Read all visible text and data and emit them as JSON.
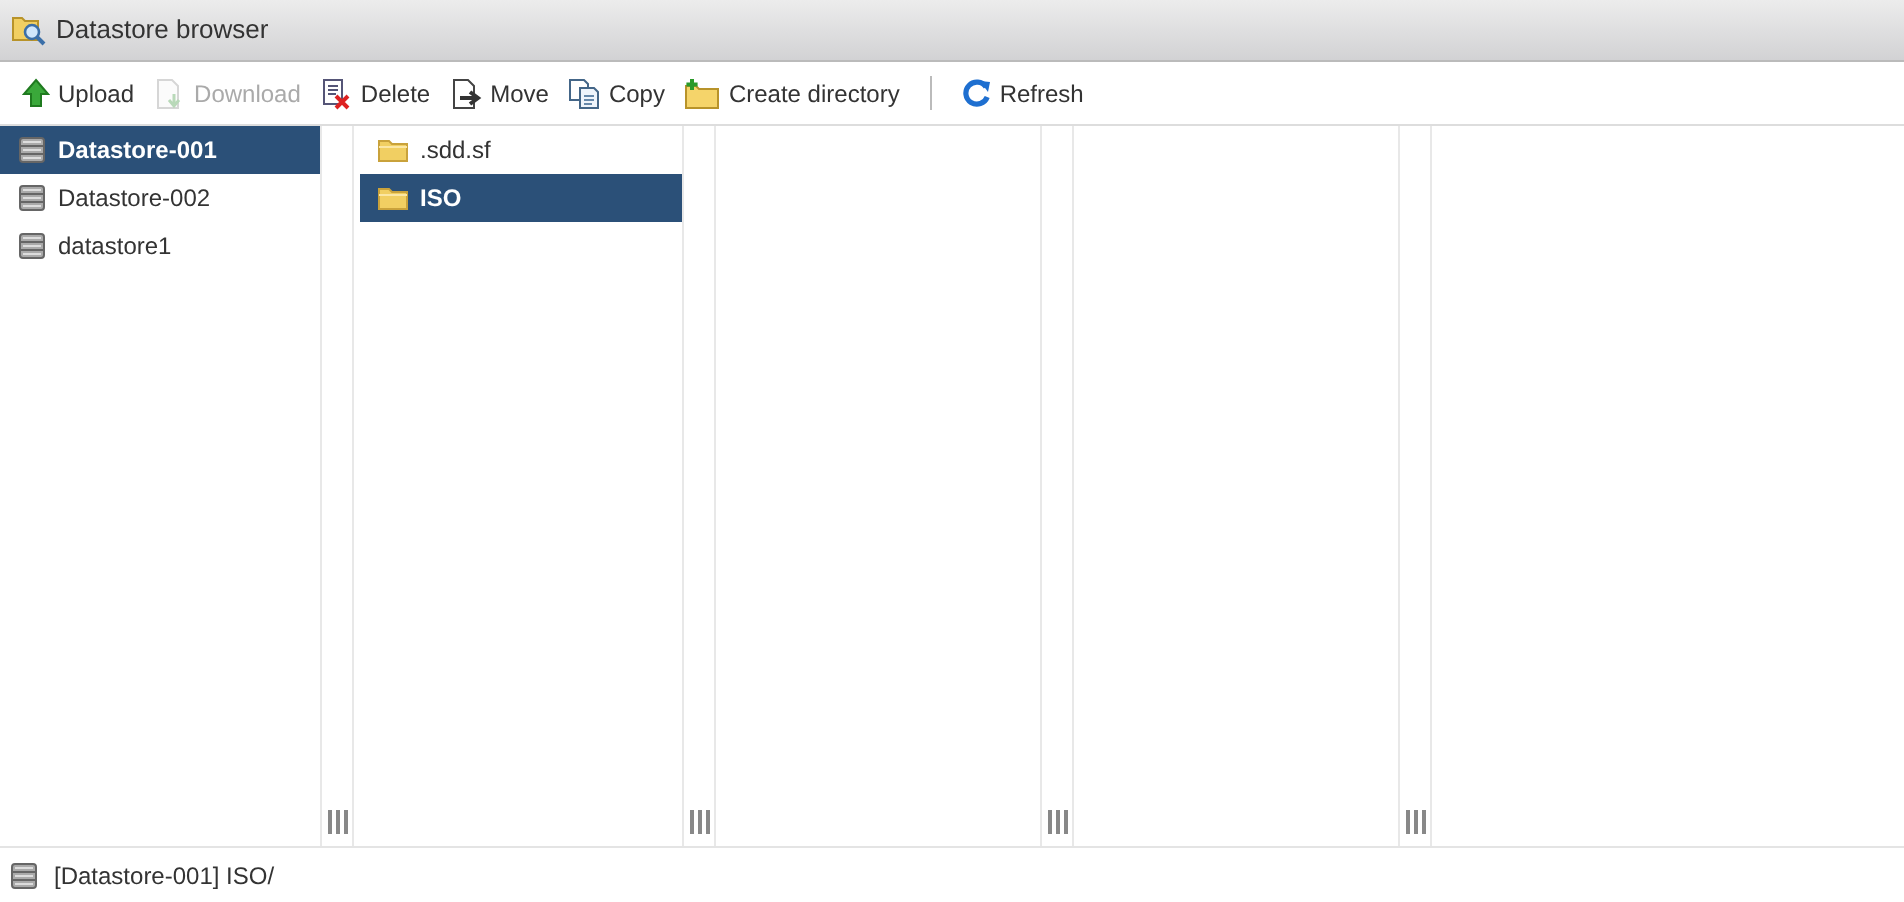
{
  "window": {
    "title": "Datastore browser"
  },
  "toolbar": [
    {
      "kind": "upload",
      "label": "Upload",
      "disabled": false
    },
    {
      "kind": "download",
      "label": "Download",
      "disabled": true
    },
    {
      "kind": "delete",
      "label": "Delete",
      "disabled": false
    },
    {
      "kind": "move",
      "label": "Move",
      "disabled": false
    },
    {
      "kind": "copy",
      "label": "Copy",
      "disabled": false
    },
    {
      "kind": "mkdir",
      "label": "Create directory",
      "disabled": false
    },
    {
      "kind": "separator"
    },
    {
      "kind": "refresh",
      "label": "Refresh",
      "disabled": false
    }
  ],
  "columns": [
    {
      "items": [
        {
          "kind": "datastore",
          "label": "Datastore-001",
          "selected": true
        },
        {
          "kind": "datastore",
          "label": "Datastore-002",
          "selected": false
        },
        {
          "kind": "datastore",
          "label": "datastore1",
          "selected": false
        }
      ]
    },
    {
      "items": [
        {
          "kind": "folder",
          "label": ".sdd.sf",
          "selected": false
        },
        {
          "kind": "folder",
          "label": "ISO",
          "selected": true
        }
      ]
    },
    {},
    {},
    {}
  ],
  "status_bar": {
    "kind": "datastore",
    "text": "[Datastore-001] ISO/"
  }
}
